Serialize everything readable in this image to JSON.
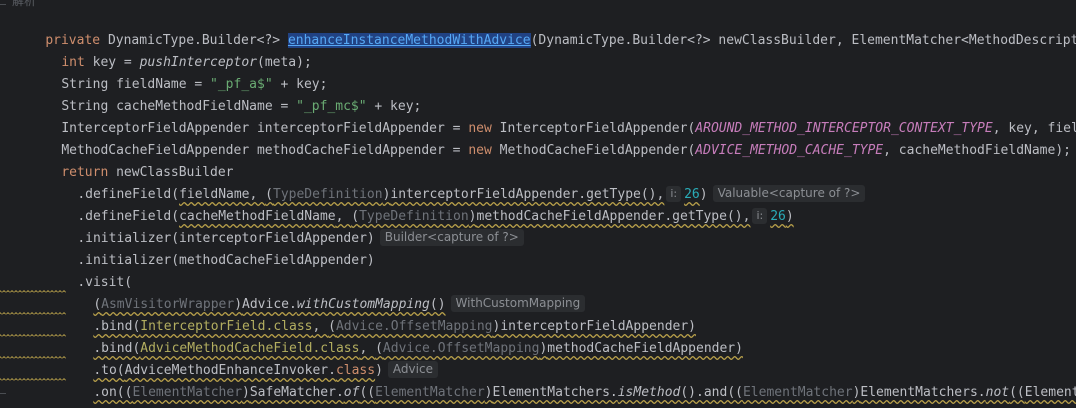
{
  "editor": {
    "top_fragment": "解析",
    "hints": {
      "param_i": "i:",
      "valuable": "Valuable<capture of ?>",
      "builder": "Builder<capture of ?>",
      "with_custom_mapping": "WithCustomMapping",
      "advice": "Advice"
    },
    "tokens": {
      "private": "private",
      "dynamic_type_builder": "DynamicType.Builder<?>",
      "method_name": "enhanceInstanceMethodWithAdvice",
      "sig_rest": "(DynamicType.Builder<?> newClassBuilder, ElementMatcher<MethodDescription>",
      "int": "int",
      "key_assign": " key = ",
      "push_interceptor": "pushInterceptor",
      "meta_arg": "(meta);",
      "string": "String",
      "field_name_assign": " fieldName = ",
      "pf_a": "\"_pf_a$\"",
      "plus_key": " + key;",
      "cache_field_assign": " cacheMethodFieldName = ",
      "pf_mc": "\"_pf_mc$\"",
      "interceptor_decl": "InterceptorFieldAppender interceptorFieldAppender = ",
      "new": "new",
      "interceptor_ctor": " InterceptorFieldAppender(",
      "around_const": "AROUND_METHOD_INTERCEPTOR_CONTEXT_TYPE",
      "interceptor_args": ", key, fieldNam",
      "method_cache_decl": "MethodCacheFieldAppender methodCacheFieldAppender = ",
      "method_cache_ctor": " MethodCacheFieldAppender(",
      "advice_const": "ADVICE_METHOD_CACHE_TYPE",
      "method_cache_args": ", cacheMethodFieldName);",
      "return": "return",
      "new_class_builder": " newClassBuilder",
      "define_field": ".defineField(",
      "field_name": "fieldName",
      "comma_sp": ", ",
      "type_definition": "TypeDefinition",
      "open_paren": "(",
      "close_paren": ")",
      "interceptor_get_type": "interceptorFieldAppender.getType(),",
      "num_26": "26",
      "cache_method_field_name": "cacheMethodFieldName",
      "method_cache_get_type": "methodCacheFieldAppender.getType(),",
      "initializer_interceptor": ".initializer(interceptorFieldAppender)",
      "initializer_method_cache": ".initializer(methodCacheFieldAppender)",
      "visit": ".visit(",
      "asm_visitor_wrapper": "AsmVisitorWrapper",
      "advice_dot": "Advice.",
      "with_custom_mapping": "withCustomMapping",
      "empty_call": "()",
      "bind": ".bind(",
      "interceptor_field_class": "InterceptorField.class",
      "advice_offset_mapping": "Advice.OffsetMapping",
      "interceptor_field_appender_close": "interceptorFieldAppender)",
      "advice_method_cache_field_class": "AdviceMethodCacheField.class",
      "method_cache_field_appender_close": "methodCacheFieldAppender)",
      "to": ".to(",
      "advice_method_enhance_invoker": "AdviceMethodEnhanceInvoker.",
      "class_kw": "class",
      "on": ".on((",
      "element_matcher": "ElementMatcher",
      "safe_matcher_of": "SafeMatcher.",
      "of": "of",
      "double_open": "((",
      "element_matchers_dot": "ElementMatchers.",
      "is_method": "isMethod",
      "and_call": "().and((",
      "not_call": "not",
      "tail_element_matche": "ElementMatche",
      "close_brace": "}"
    }
  }
}
